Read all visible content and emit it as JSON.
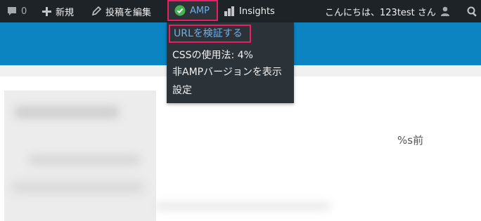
{
  "adminbar": {
    "comments_count": "0",
    "new_label": "新規",
    "edit_label": "投稿を編集",
    "amp_label": "AMP",
    "insights_label": "Insights",
    "greeting": "こんにちは、123test さん"
  },
  "amp_menu": {
    "items": [
      "URLを検証する",
      "CSSの使用法: 4%",
      "非AMPバージョンを表示",
      "設定"
    ]
  },
  "content": {
    "time_ago": "%s前"
  },
  "colors": {
    "adminbar_bg": "#1d2327",
    "submenu_bg": "#2c3338",
    "header_blue": "#0b84c1",
    "highlight_border": "#e91e63",
    "link_blue": "#72aee6",
    "amp_check_green": "#46b450"
  },
  "icons": [
    "comment-icon",
    "plus-icon",
    "pencil-icon",
    "check-circle-icon",
    "bar-chart-icon",
    "user-avatar-icon",
    "search-icon"
  ]
}
